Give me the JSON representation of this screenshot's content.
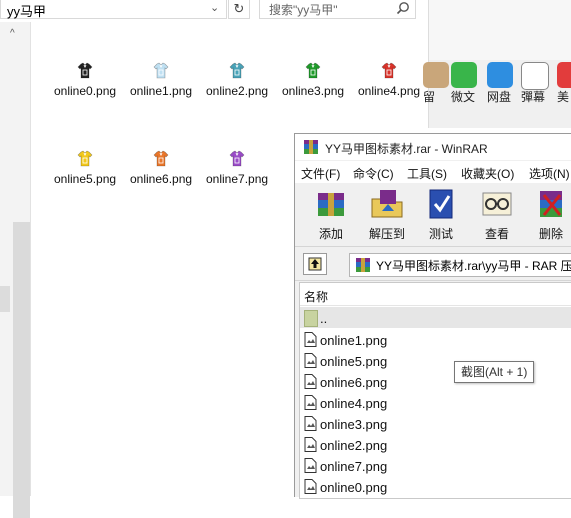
{
  "explorer": {
    "address_text": "yy马甲",
    "dropdown_glyph": "⌄",
    "refresh_glyph": "↻",
    "search_placeholder": "搜索\"yy马甲\"",
    "scroll_up_glyph": "^",
    "files": [
      {
        "name": "online0.png",
        "color": "#222222"
      },
      {
        "name": "online1.png",
        "color": "#bfe0f2"
      },
      {
        "name": "online2.png",
        "color": "#4aa3b8"
      },
      {
        "name": "online3.png",
        "color": "#1f9a2a"
      },
      {
        "name": "online4.png",
        "color": "#d8332a"
      },
      {
        "name": "online5.png",
        "color": "#f2c81c"
      },
      {
        "name": "online6.png",
        "color": "#e9762a"
      },
      {
        "name": "online7.png",
        "color": "#9a4cc8"
      }
    ]
  },
  "background_app": {
    "items": [
      {
        "label": "留",
        "color": "#c9a67a"
      },
      {
        "label": "微文",
        "color": "#39b54a"
      },
      {
        "label": "网盘",
        "color": "#2e8ee0"
      },
      {
        "label": "彈幕",
        "color": "#ffffff"
      },
      {
        "label": "美",
        "color": "#e23c3c"
      }
    ]
  },
  "winrar": {
    "title": "YY马甲图标素材.rar - WinRAR",
    "menu": [
      "文件(F)",
      "命令(C)",
      "工具(S)",
      "收藏夹(O)",
      "选项(N)"
    ],
    "toolbar": [
      "添加",
      "解压到",
      "测试",
      "查看",
      "删除"
    ],
    "path": "YY马甲图标素材.rar\\yy马甲 - RAR 压",
    "column_name": "名称",
    "parent_row": "..",
    "rows": [
      "online1.png",
      "online5.png",
      "online6.png",
      "online4.png",
      "online3.png",
      "online2.png",
      "online7.png",
      "online0.png"
    ]
  },
  "tooltip": "截图(Alt + 1)"
}
